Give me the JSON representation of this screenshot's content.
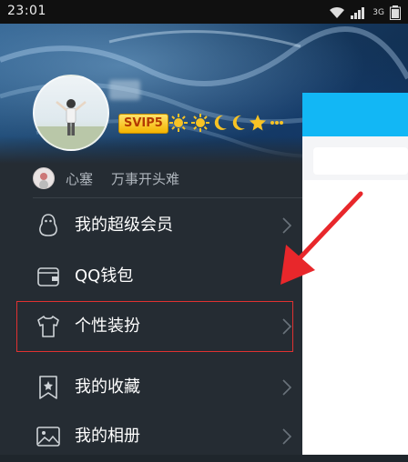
{
  "status_bar": {
    "time": "23:01",
    "network": "3G"
  },
  "profile": {
    "vip_badge": "SVIP5"
  },
  "signature": {
    "name": "心塞",
    "text": "万事开头难"
  },
  "menu": [
    {
      "label": "我的超级会员",
      "icon": "penguin-icon"
    },
    {
      "label": "QQ钱包",
      "icon": "wallet-icon"
    },
    {
      "label": "个性装扮",
      "icon": "tshirt-icon"
    },
    {
      "label": "我的收藏",
      "icon": "bookmark-star-icon"
    },
    {
      "label": "我的相册",
      "icon": "photo-icon"
    }
  ],
  "colors": {
    "drawer_bg": "#252c33",
    "accent_blue": "#12b7f5",
    "highlight_red": "#e03131",
    "vip_gold": "#f5b400"
  }
}
